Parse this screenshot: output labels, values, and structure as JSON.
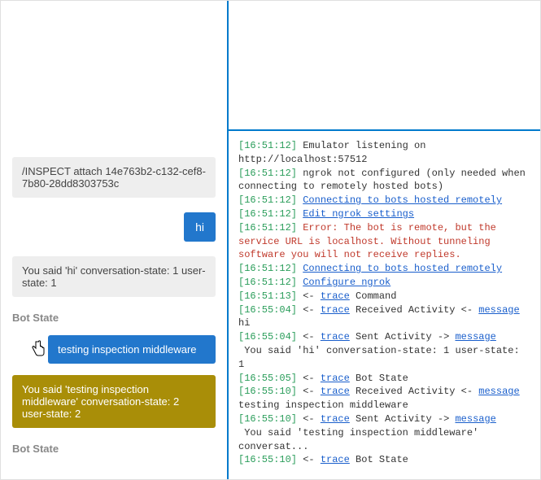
{
  "chat": {
    "system_attach": "/INSPECT attach 14e763b2-c132-cef8-7b80-28dd8303753c",
    "user_hi": "hi",
    "bot_reply_1": "You said 'hi' conversation-state: 1 user-state: 1",
    "bot_state_label": "Bot State",
    "user_testing": "testing inspection middleware",
    "bot_reply_2": "You said 'testing inspection middleware' conversation-state: 2 user-state: 2",
    "bot_state_label_2": "Bot State"
  },
  "log": {
    "lines": [
      {
        "ts": "[16:51:12]",
        "parts": [
          {
            "t": "plain",
            "v": " Emulator listening on http://localhost:57512"
          }
        ]
      },
      {
        "ts": "[16:51:12]",
        "parts": [
          {
            "t": "plain",
            "v": " ngrok not configured (only needed when connecting to remotely hosted bots)"
          }
        ]
      },
      {
        "ts": "[16:51:12]",
        "parts": [
          {
            "t": "plain",
            "v": " "
          },
          {
            "t": "link",
            "v": "Connecting to bots hosted remotely"
          }
        ]
      },
      {
        "ts": "[16:51:12]",
        "parts": [
          {
            "t": "plain",
            "v": " "
          },
          {
            "t": "link",
            "v": "Edit ngrok settings"
          }
        ]
      },
      {
        "ts": "[16:51:12]",
        "parts": [
          {
            "t": "err",
            "v": " Error: The bot is remote, but the service URL is localhost. Without tunneling software you will not receive replies."
          }
        ]
      },
      {
        "ts": "[16:51:12]",
        "parts": [
          {
            "t": "plain",
            "v": " "
          },
          {
            "t": "link",
            "v": "Connecting to bots hosted remotely"
          }
        ]
      },
      {
        "ts": "[16:51:12]",
        "parts": [
          {
            "t": "plain",
            "v": " "
          },
          {
            "t": "link",
            "v": "Configure ngrok"
          }
        ]
      },
      {
        "ts": "[16:51:13]",
        "parts": [
          {
            "t": "plain",
            "v": " <- "
          },
          {
            "t": "link",
            "v": "trace"
          },
          {
            "t": "plain",
            "v": " Command"
          }
        ]
      },
      {
        "ts": "[16:55:04]",
        "parts": [
          {
            "t": "plain",
            "v": " <- "
          },
          {
            "t": "link",
            "v": "trace"
          },
          {
            "t": "plain",
            "v": " Received Activity <- "
          },
          {
            "t": "link",
            "v": "message"
          },
          {
            "t": "plain",
            "v": " hi"
          }
        ]
      },
      {
        "ts": "[16:55:04]",
        "parts": [
          {
            "t": "plain",
            "v": " <- "
          },
          {
            "t": "link",
            "v": "trace"
          },
          {
            "t": "plain",
            "v": " Sent Activity -> "
          },
          {
            "t": "link",
            "v": "message"
          },
          {
            "t": "plain",
            "v": "\n You said 'hi' conversation-state: 1 user-state: 1"
          }
        ]
      },
      {
        "ts": "[16:55:05]",
        "parts": [
          {
            "t": "plain",
            "v": " <- "
          },
          {
            "t": "link",
            "v": "trace"
          },
          {
            "t": "plain",
            "v": " Bot State"
          }
        ]
      },
      {
        "ts": "[16:55:10]",
        "parts": [
          {
            "t": "plain",
            "v": " <- "
          },
          {
            "t": "link",
            "v": "trace"
          },
          {
            "t": "plain",
            "v": " Received Activity <- "
          },
          {
            "t": "link",
            "v": "message"
          },
          {
            "t": "plain",
            "v": " testing inspection middleware"
          }
        ]
      },
      {
        "ts": "[16:55:10]",
        "parts": [
          {
            "t": "plain",
            "v": " <- "
          },
          {
            "t": "link",
            "v": "trace"
          },
          {
            "t": "plain",
            "v": " Sent Activity -> "
          },
          {
            "t": "link",
            "v": "message"
          },
          {
            "t": "plain",
            "v": "\n You said 'testing inspection middleware' conversat..."
          }
        ]
      },
      {
        "ts": "[16:55:10]",
        "parts": [
          {
            "t": "plain",
            "v": " <- "
          },
          {
            "t": "link",
            "v": "trace"
          },
          {
            "t": "plain",
            "v": " Bot State"
          }
        ]
      }
    ]
  }
}
